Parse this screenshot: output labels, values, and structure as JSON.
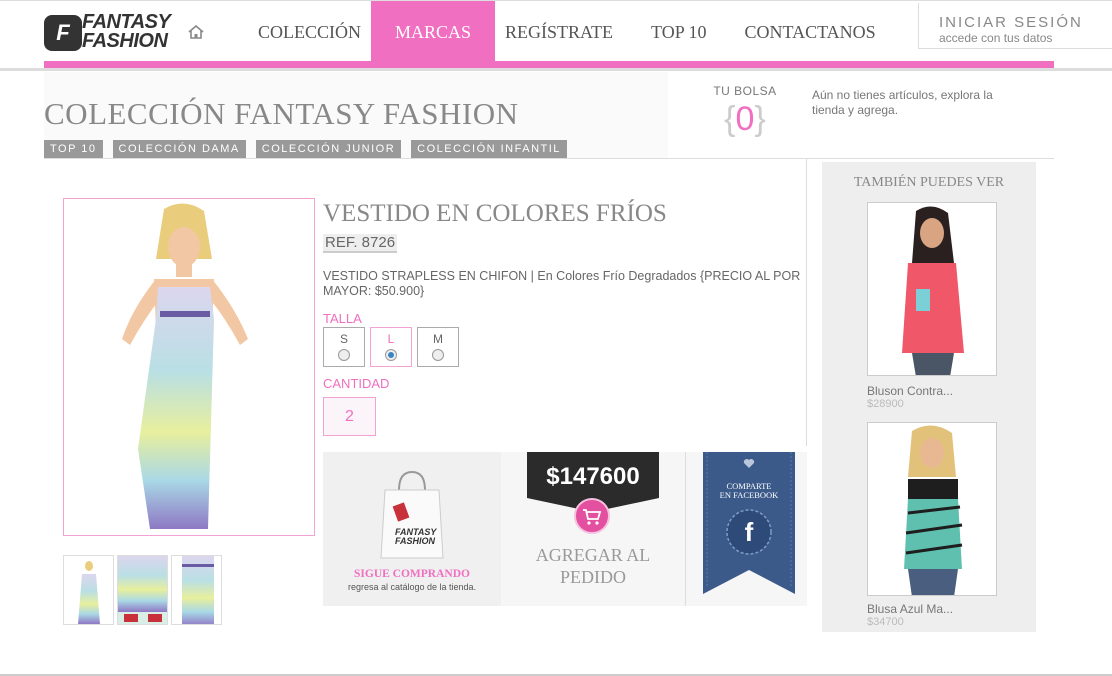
{
  "header": {
    "logo_line1": "FANTASY",
    "logo_line2": "FASHION",
    "logo_mark": "F",
    "nav": [
      "COLECCIÓN",
      "MARCAS",
      "REGÍSTRATE",
      "TOP 10",
      "CONTACTANOS"
    ],
    "active_nav": "MARCAS",
    "login_title": "INICIAR SESIÓN",
    "login_sub": "accede con tus datos"
  },
  "title_area": {
    "title": "COLECCIÓN FANTASY FASHION",
    "tags": [
      "TOP 10",
      "COLECCIÓN DAMA",
      "COLECCIÓN JUNIOR",
      "COLECCIÓN INFANTIL"
    ]
  },
  "bag": {
    "label": "TU BOLSA",
    "open": "{",
    "count": "0",
    "close": "}",
    "message": "Aún no tienes artículos, explora la tienda y agrega."
  },
  "product": {
    "name": "VESTIDO EN COLORES FRÍOS",
    "ref": "REF. 8726",
    "description": "VESTIDO STRAPLESS EN CHIFON | En Colores Frío Degradados {PRECIO AL POR MAYOR: $50.900}",
    "size_label": "TALLA",
    "sizes": [
      "S",
      "L",
      "M"
    ],
    "selected_size": "L",
    "qty_label": "CANTIDAD",
    "qty": "2"
  },
  "actions": {
    "keep_title": "SIGUE COMPRANDO",
    "keep_sub": "regresa al catálogo de la tienda.",
    "bag_brand_1": "FANTASY",
    "bag_brand_2": "FASHION",
    "price": "$147600",
    "add_label": "AGREGAR AL PEDIDO",
    "share_line1": "COMPARTE",
    "share_line2": "EN FACEBOOK",
    "fb_letter": "f"
  },
  "sidebar": {
    "title": "TAMBIÉN PUEDES VER",
    "items": [
      {
        "name": "Bluson Contra...",
        "price": "$28900"
      },
      {
        "name": "Blusa Azul Ma...",
        "price": "$34700"
      }
    ]
  },
  "colors": {
    "accent": "#f06fc0",
    "text": "#666666",
    "dark": "#2b2b2b",
    "facebook": "#3b5a8a"
  },
  "icons": [
    "home-icon",
    "cart-icon",
    "heart-icon",
    "facebook-icon",
    "shopping-bag-icon"
  ]
}
